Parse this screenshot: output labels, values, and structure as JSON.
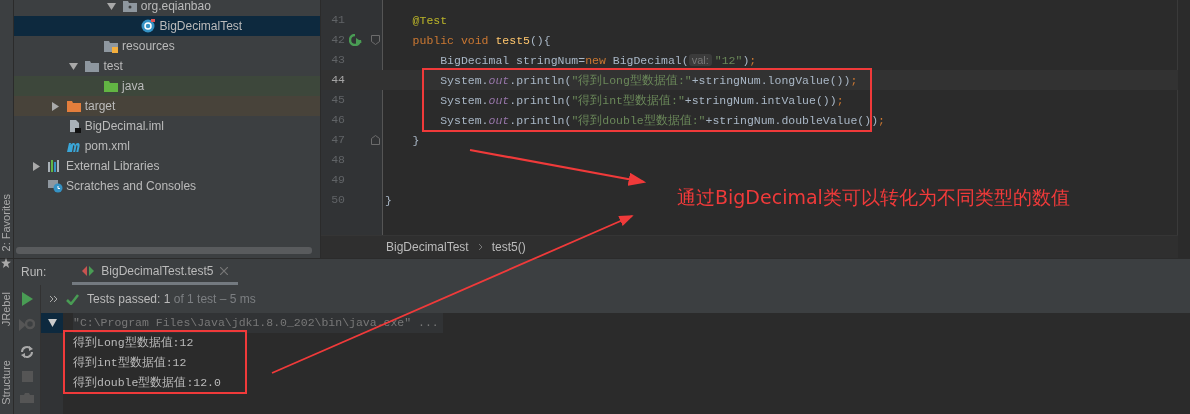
{
  "side_stripe": {
    "labels": [
      "2: Favorites",
      "JRebel",
      "Structure"
    ]
  },
  "tree": [
    {
      "children": [
        {
          "children": [
            {
              "children": [
                {
                  "children": [
                    {
                      "label": "org.eqianbao",
                      "kind": "package",
                      "expanded": true,
                      "selected": false,
                      "children": [
                        {
                          "label": "BigDecimalTest",
                          "kind": "test-class",
                          "selected": true
                        }
                      ]
                    }
                  ]
                },
                {
                  "label": "resources",
                  "kind": "resources",
                  "selected": false
                }
              ]
            },
            {
              "label": "test",
              "kind": "folder",
              "expanded": true,
              "selected": false,
              "children": [
                {
                  "label": "java",
                  "kind": "test-source",
                  "selected": false
                }
              ]
            }
          ]
        },
        {
          "label": "target",
          "kind": "excluded",
          "expanded": false,
          "selected": false
        },
        {
          "label": "BigDecimal.iml",
          "kind": "iml",
          "selected": false
        },
        {
          "label": "pom.xml",
          "kind": "maven",
          "selected": false
        }
      ]
    },
    {
      "label": "External Libraries",
      "kind": "libraries",
      "expanded": false,
      "selected": false
    },
    {
      "label": "Scratches and Consoles",
      "kind": "scratches",
      "selected": false
    }
  ],
  "editor": {
    "lines": [
      {
        "number": "41",
        "tokens": [
          {
            "kind": "annotation",
            "text": "    @Test"
          }
        ]
      },
      {
        "number": "42",
        "run_icon": true,
        "fold_start": true,
        "tokens": [
          {
            "kind": "keyword",
            "text": "    public void "
          },
          {
            "kind": "method",
            "text": "test5"
          },
          {
            "kind": "plain",
            "text": "(){"
          }
        ]
      },
      {
        "number": "43",
        "tokens": [
          {
            "kind": "plain",
            "text": "        BigDecimal stringNum="
          },
          {
            "kind": "keyword",
            "text": "new"
          },
          {
            "kind": "plain",
            "text": " BigDecimal("
          },
          {
            "kind": "hint",
            "text": "val:"
          },
          {
            "kind": "string",
            "text": "\"12\""
          },
          {
            "kind": "plain",
            "text": ")"
          },
          {
            "kind": "keyword",
            "text": ";"
          }
        ]
      },
      {
        "number": "44",
        "current": true,
        "tokens": [
          {
            "kind": "plain",
            "text": "        System."
          },
          {
            "kind": "static",
            "text": "out"
          },
          {
            "kind": "plain",
            "text": ".println("
          },
          {
            "kind": "string",
            "text": "\"得到Long型数据值:\""
          },
          {
            "kind": "plain",
            "text": "+stringNum.longValue())"
          },
          {
            "kind": "keyword",
            "text": ";"
          }
        ]
      },
      {
        "number": "45",
        "tokens": [
          {
            "kind": "plain",
            "text": "        System."
          },
          {
            "kind": "static",
            "text": "out"
          },
          {
            "kind": "plain",
            "text": ".println("
          },
          {
            "kind": "string",
            "text": "\"得到int型数据值:\""
          },
          {
            "kind": "plain",
            "text": "+stringNum.intValue())"
          },
          {
            "kind": "keyword",
            "text": ";"
          }
        ]
      },
      {
        "number": "46",
        "tokens": [
          {
            "kind": "plain",
            "text": "        System."
          },
          {
            "kind": "static",
            "text": "out"
          },
          {
            "kind": "plain",
            "text": ".println("
          },
          {
            "kind": "string",
            "text": "\"得到double型数据值:\""
          },
          {
            "kind": "plain",
            "text": "+stringNum.doubleValue())"
          },
          {
            "kind": "keyword",
            "text": ";"
          }
        ]
      },
      {
        "number": "47",
        "fold_end": true,
        "tokens": [
          {
            "kind": "plain",
            "text": "    }"
          }
        ]
      },
      {
        "number": "48"
      },
      {
        "number": "49"
      },
      {
        "number": "50",
        "tokens": [
          {
            "kind": "plain",
            "text": "}"
          }
        ]
      }
    ]
  },
  "breadcrumbs": [
    "BigDecimalTest",
    "test5()"
  ],
  "run": {
    "label": "Run:",
    "tabs": [
      {
        "label": "BigDecimalTest.test5",
        "selected": true
      }
    ],
    "status": {
      "passed": "Tests passed: 1",
      "detail": "of 1 test – 5 ms"
    },
    "console": [
      {
        "kind": "command",
        "text": "\"C:\\Program Files\\Java\\jdk1.8.0_202\\bin\\java.exe\" ..."
      },
      {
        "kind": "output",
        "text": "得到Long型数据值:12"
      },
      {
        "kind": "output",
        "text": "得到int型数据值:12"
      },
      {
        "kind": "output",
        "text": "得到double型数据值:12.0"
      }
    ]
  },
  "annotation": {
    "text": "通过BigDecimal类可以转化为不同类型的数值"
  }
}
